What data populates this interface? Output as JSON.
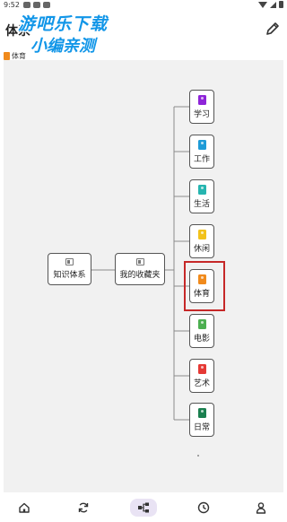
{
  "status_bar": {
    "time": "9:52"
  },
  "header": {
    "title": "体系",
    "edit_icon": "pencil-icon"
  },
  "watermark": {
    "line1": "游吧乐下载",
    "line2": "小编亲测"
  },
  "breadcrumb": {
    "label": "体育",
    "color": "#f08a1c"
  },
  "mindmap": {
    "root": {
      "label": "知识体系",
      "icon": "book-stack-icon"
    },
    "hub": {
      "label": "我的收藏夹",
      "icon": "book-stack-icon"
    },
    "categories": [
      {
        "label": "学习",
        "color": "#8e24d8"
      },
      {
        "label": "工作",
        "color": "#1e9bd7"
      },
      {
        "label": "生活",
        "color": "#26b5b0"
      },
      {
        "label": "休闲",
        "color": "#f2c21b"
      },
      {
        "label": "体育",
        "color": "#f08a1c",
        "selected": true
      },
      {
        "label": "电影",
        "color": "#4caf50"
      },
      {
        "label": "艺术",
        "color": "#e53935"
      },
      {
        "label": "日常",
        "color": "#1a7f4f"
      }
    ]
  },
  "bottom_nav": [
    {
      "icon": "home-icon"
    },
    {
      "icon": "refresh-icon"
    },
    {
      "icon": "mindmap-icon",
      "active": true
    },
    {
      "icon": "clock-icon"
    },
    {
      "icon": "profile-icon"
    }
  ]
}
